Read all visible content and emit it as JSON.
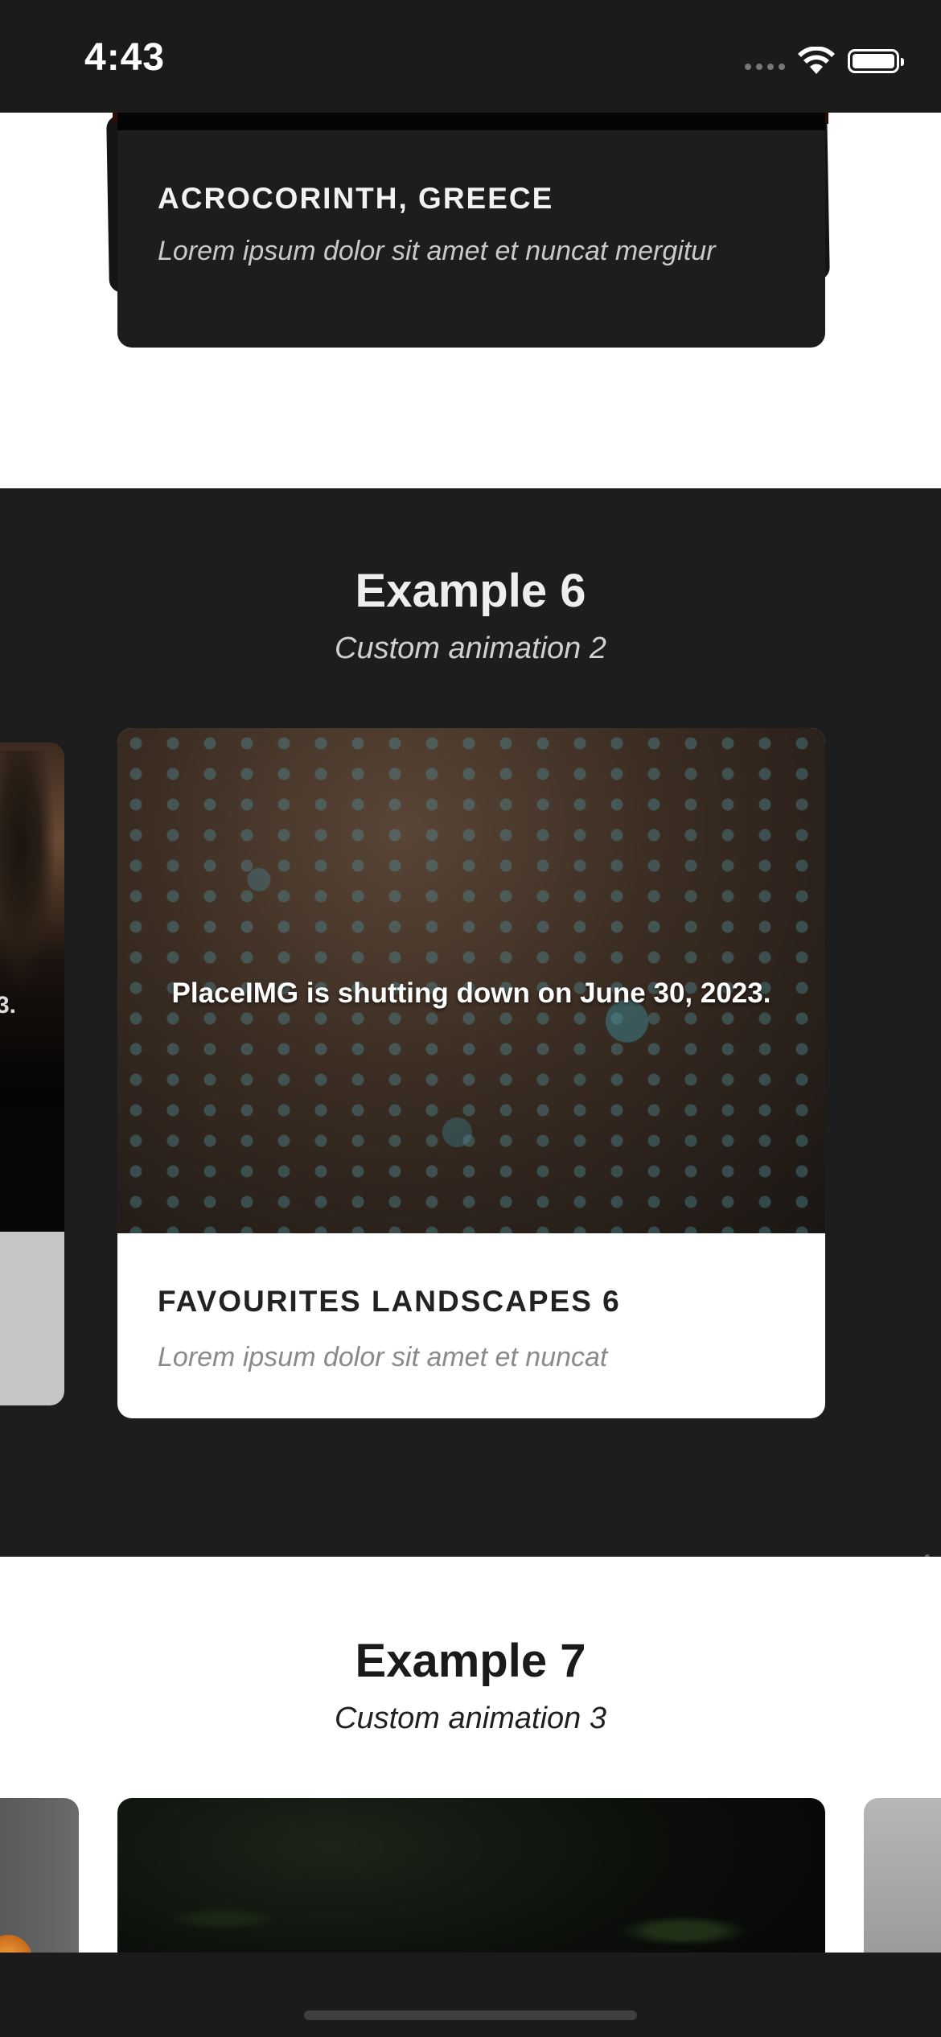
{
  "status_bar": {
    "time": "4:43",
    "icons": [
      "cellular-signal-icon",
      "wifi-icon",
      "battery-icon"
    ]
  },
  "example5": {
    "card": {
      "title": "ACROCORINTH, GREECE",
      "text": "Lorem ipsum dolor sit amet et nuncat mergitur"
    }
  },
  "example6": {
    "title": "Example 6",
    "subtitle": "Custom animation 2",
    "previous_card_caption": "3.",
    "card": {
      "image_notice": "PlaceIMG is shutting down on June 30, 2023.",
      "title": "FAVOURITES LANDSCAPES 6",
      "text": "Lorem ipsum dolor sit amet et nuncat"
    }
  },
  "example7": {
    "title": "Example 7",
    "subtitle": "Custom animation 3"
  },
  "colors": {
    "dark_background": "#1d1d1d",
    "light_background": "#ffffff",
    "card_dark": "#1d1d1d",
    "card_light": "#ffffff"
  }
}
